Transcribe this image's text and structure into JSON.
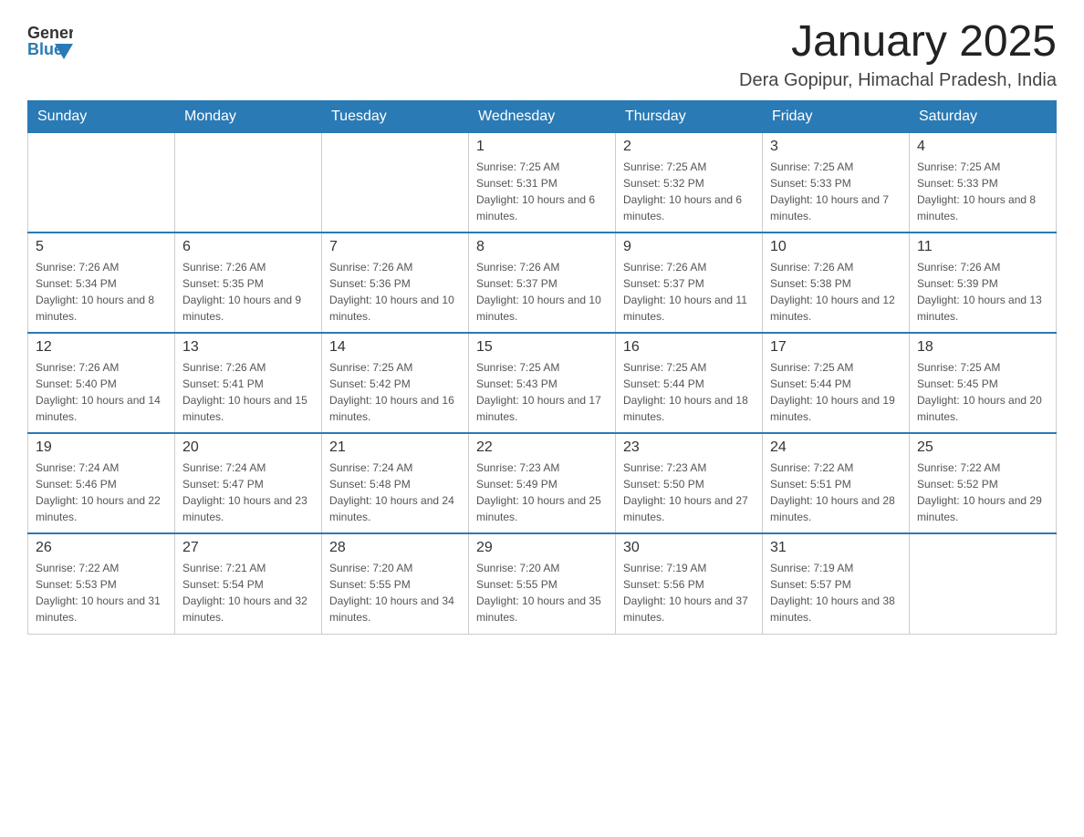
{
  "header": {
    "logo": {
      "text_general": "General",
      "text_blue": "Blue"
    },
    "title": "January 2025",
    "location": "Dera Gopipur, Himachal Pradesh, India"
  },
  "days_of_week": [
    "Sunday",
    "Monday",
    "Tuesday",
    "Wednesday",
    "Thursday",
    "Friday",
    "Saturday"
  ],
  "weeks": [
    [
      {
        "day": "",
        "info": ""
      },
      {
        "day": "",
        "info": ""
      },
      {
        "day": "",
        "info": ""
      },
      {
        "day": "1",
        "info": "Sunrise: 7:25 AM\nSunset: 5:31 PM\nDaylight: 10 hours and 6 minutes."
      },
      {
        "day": "2",
        "info": "Sunrise: 7:25 AM\nSunset: 5:32 PM\nDaylight: 10 hours and 6 minutes."
      },
      {
        "day": "3",
        "info": "Sunrise: 7:25 AM\nSunset: 5:33 PM\nDaylight: 10 hours and 7 minutes."
      },
      {
        "day": "4",
        "info": "Sunrise: 7:25 AM\nSunset: 5:33 PM\nDaylight: 10 hours and 8 minutes."
      }
    ],
    [
      {
        "day": "5",
        "info": "Sunrise: 7:26 AM\nSunset: 5:34 PM\nDaylight: 10 hours and 8 minutes."
      },
      {
        "day": "6",
        "info": "Sunrise: 7:26 AM\nSunset: 5:35 PM\nDaylight: 10 hours and 9 minutes."
      },
      {
        "day": "7",
        "info": "Sunrise: 7:26 AM\nSunset: 5:36 PM\nDaylight: 10 hours and 10 minutes."
      },
      {
        "day": "8",
        "info": "Sunrise: 7:26 AM\nSunset: 5:37 PM\nDaylight: 10 hours and 10 minutes."
      },
      {
        "day": "9",
        "info": "Sunrise: 7:26 AM\nSunset: 5:37 PM\nDaylight: 10 hours and 11 minutes."
      },
      {
        "day": "10",
        "info": "Sunrise: 7:26 AM\nSunset: 5:38 PM\nDaylight: 10 hours and 12 minutes."
      },
      {
        "day": "11",
        "info": "Sunrise: 7:26 AM\nSunset: 5:39 PM\nDaylight: 10 hours and 13 minutes."
      }
    ],
    [
      {
        "day": "12",
        "info": "Sunrise: 7:26 AM\nSunset: 5:40 PM\nDaylight: 10 hours and 14 minutes."
      },
      {
        "day": "13",
        "info": "Sunrise: 7:26 AM\nSunset: 5:41 PM\nDaylight: 10 hours and 15 minutes."
      },
      {
        "day": "14",
        "info": "Sunrise: 7:25 AM\nSunset: 5:42 PM\nDaylight: 10 hours and 16 minutes."
      },
      {
        "day": "15",
        "info": "Sunrise: 7:25 AM\nSunset: 5:43 PM\nDaylight: 10 hours and 17 minutes."
      },
      {
        "day": "16",
        "info": "Sunrise: 7:25 AM\nSunset: 5:44 PM\nDaylight: 10 hours and 18 minutes."
      },
      {
        "day": "17",
        "info": "Sunrise: 7:25 AM\nSunset: 5:44 PM\nDaylight: 10 hours and 19 minutes."
      },
      {
        "day": "18",
        "info": "Sunrise: 7:25 AM\nSunset: 5:45 PM\nDaylight: 10 hours and 20 minutes."
      }
    ],
    [
      {
        "day": "19",
        "info": "Sunrise: 7:24 AM\nSunset: 5:46 PM\nDaylight: 10 hours and 22 minutes."
      },
      {
        "day": "20",
        "info": "Sunrise: 7:24 AM\nSunset: 5:47 PM\nDaylight: 10 hours and 23 minutes."
      },
      {
        "day": "21",
        "info": "Sunrise: 7:24 AM\nSunset: 5:48 PM\nDaylight: 10 hours and 24 minutes."
      },
      {
        "day": "22",
        "info": "Sunrise: 7:23 AM\nSunset: 5:49 PM\nDaylight: 10 hours and 25 minutes."
      },
      {
        "day": "23",
        "info": "Sunrise: 7:23 AM\nSunset: 5:50 PM\nDaylight: 10 hours and 27 minutes."
      },
      {
        "day": "24",
        "info": "Sunrise: 7:22 AM\nSunset: 5:51 PM\nDaylight: 10 hours and 28 minutes."
      },
      {
        "day": "25",
        "info": "Sunrise: 7:22 AM\nSunset: 5:52 PM\nDaylight: 10 hours and 29 minutes."
      }
    ],
    [
      {
        "day": "26",
        "info": "Sunrise: 7:22 AM\nSunset: 5:53 PM\nDaylight: 10 hours and 31 minutes."
      },
      {
        "day": "27",
        "info": "Sunrise: 7:21 AM\nSunset: 5:54 PM\nDaylight: 10 hours and 32 minutes."
      },
      {
        "day": "28",
        "info": "Sunrise: 7:20 AM\nSunset: 5:55 PM\nDaylight: 10 hours and 34 minutes."
      },
      {
        "day": "29",
        "info": "Sunrise: 7:20 AM\nSunset: 5:55 PM\nDaylight: 10 hours and 35 minutes."
      },
      {
        "day": "30",
        "info": "Sunrise: 7:19 AM\nSunset: 5:56 PM\nDaylight: 10 hours and 37 minutes."
      },
      {
        "day": "31",
        "info": "Sunrise: 7:19 AM\nSunset: 5:57 PM\nDaylight: 10 hours and 38 minutes."
      },
      {
        "day": "",
        "info": ""
      }
    ]
  ]
}
